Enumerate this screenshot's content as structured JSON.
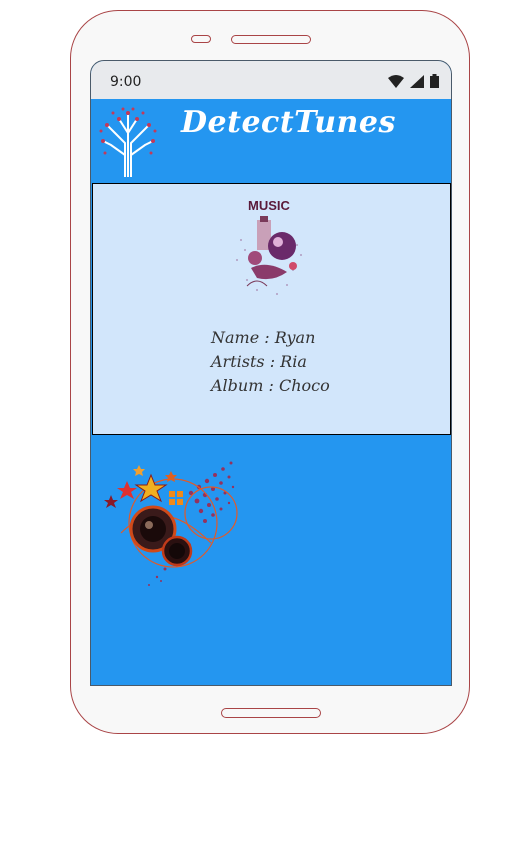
{
  "status_bar": {
    "time": "9:00",
    "icons": [
      "wifi-icon",
      "signal-icon",
      "battery-icon"
    ]
  },
  "header": {
    "title": "DetectTunes",
    "logo_icon": "tree-logo-icon"
  },
  "song": {
    "album_art_label": "MUSIC",
    "name_label": "Name : ",
    "name": "Ryan",
    "artists_label": "Artists : ",
    "artists": "Ria",
    "album_label": "Album : ",
    "album": "Choco"
  },
  "colors": {
    "background": "#2496f0",
    "card": "#d2e6fb",
    "status_bar": "#e8eaed",
    "phone_outline": "#a94446"
  }
}
